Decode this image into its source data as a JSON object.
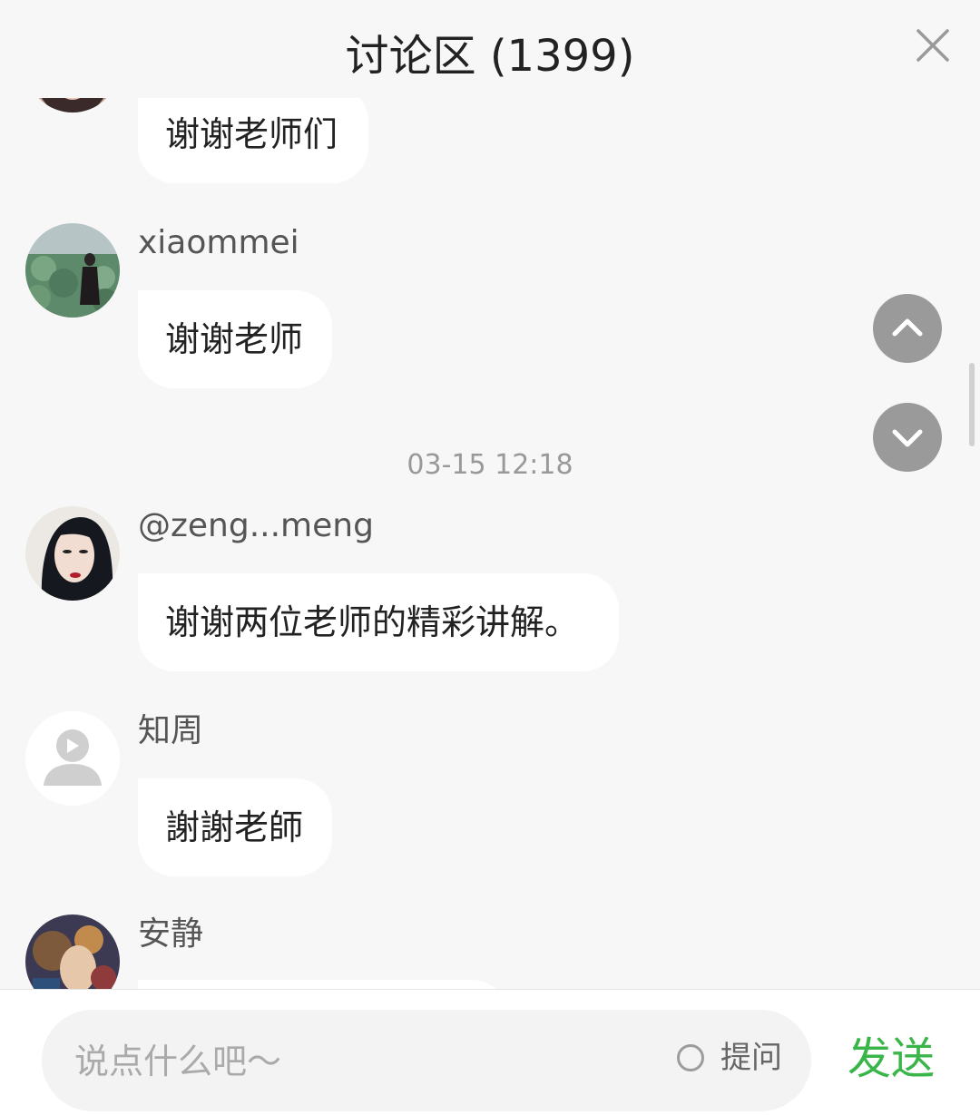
{
  "header": {
    "title": "讨论区 (1399)"
  },
  "messages": [
    {
      "username": "",
      "text": "谢谢老师们",
      "avatar": "woman-portrait-avatar"
    },
    {
      "username": "xiaommei",
      "text": "谢谢老师",
      "avatar": "lotus-field-avatar"
    },
    {
      "username": "@zeng...meng",
      "text": "谢谢两位老师的精彩讲解。",
      "avatar": "illustrated-woman-avatar"
    },
    {
      "username": "知周",
      "text": "謝謝老師",
      "avatar": "default-user-avatar"
    },
    {
      "username": "安静",
      "text": "",
      "avatar": "painted-portrait-avatar"
    }
  ],
  "timestamp": "03-15 12:18",
  "composer": {
    "placeholder": "说点什么吧～",
    "question_label": "提问",
    "send_label": "发送"
  },
  "colors": {
    "background": "#f7f7f7",
    "bubble": "#ffffff",
    "send": "#39b54a",
    "scroll_button": "#9a9a9a"
  },
  "icons": [
    "close-icon",
    "chevron-up-icon",
    "chevron-down-icon",
    "radio-icon"
  ]
}
